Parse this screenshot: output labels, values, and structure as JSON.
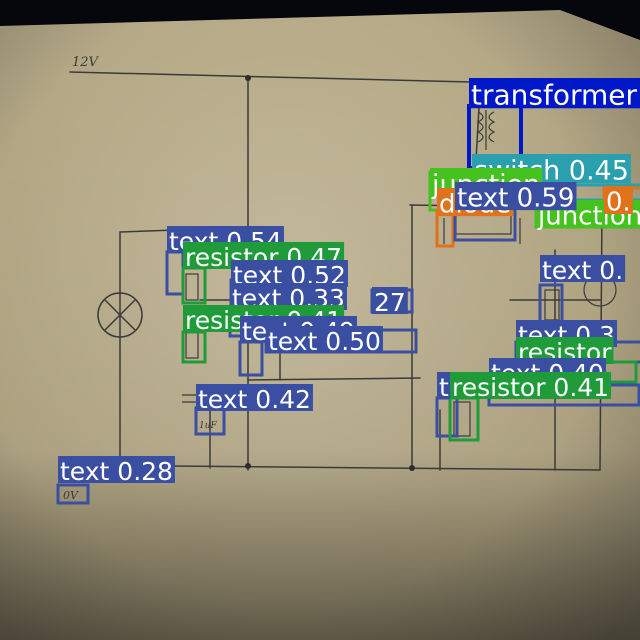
{
  "handwritten": {
    "supply_label": "12V",
    "left_terminal": "0V",
    "cap_value": "1uF"
  },
  "detections": [
    {
      "label": "transformer 0.60",
      "color": "#0018c8"
    },
    {
      "label": "switch 0.45",
      "color": "#2a9fae"
    },
    {
      "label": "junction",
      "color": "#45c21f"
    },
    {
      "label": "diode",
      "color": "#e0721c"
    },
    {
      "label": "junction",
      "color": "#45c21f"
    },
    {
      "label": "0.",
      "color": "#e0721c"
    },
    {
      "label": "text 0.59",
      "color": "#3a4fa1"
    },
    {
      "label": "text 0.54",
      "color": "#3a4fa1"
    },
    {
      "label": "resistor 0.47",
      "color": "#1f9b3a"
    },
    {
      "label": "text 0.52",
      "color": "#3a4fa1"
    },
    {
      "label": "text 0.33",
      "color": "#3a4fa1"
    },
    {
      "label": "27",
      "color": "#3a4fa1"
    },
    {
      "label": "resistor 0.41",
      "color": "#1f9b3a"
    },
    {
      "label": "text 0.49",
      "color": "#3a4fa1"
    },
    {
      "label": "text 0.50",
      "color": "#3a4fa1"
    },
    {
      "label": "text 0.42",
      "color": "#3a4fa1"
    },
    {
      "label": "text 0.28",
      "color": "#3a4fa1"
    },
    {
      "label": "text 0.",
      "color": "#3a4fa1"
    },
    {
      "label": "text 0.3",
      "color": "#3a4fa1"
    },
    {
      "label": "resistor",
      "color": "#1f9b3a"
    },
    {
      "label": "text 0.40",
      "color": "#3a4fa1"
    },
    {
      "label": "t",
      "color": "#3a4fa1"
    },
    {
      "label": "resistor 0.41",
      "color": "#1f9b3a"
    }
  ]
}
